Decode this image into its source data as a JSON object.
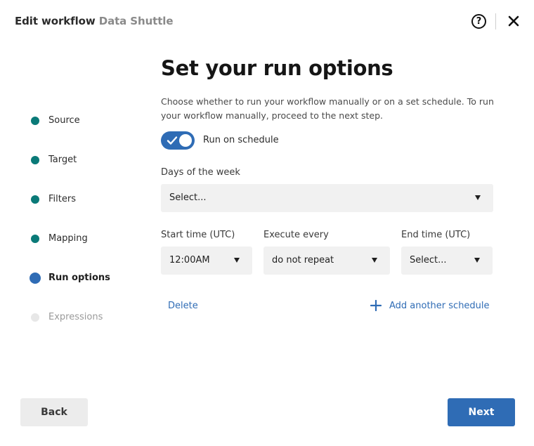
{
  "header": {
    "title_prefix": "Edit workflow",
    "workflow_name": "Data Shuttle",
    "help_icon": "question-circle-icon",
    "close_icon": "close-x-icon",
    "help_glyph": "?"
  },
  "steps": [
    {
      "label": "Source",
      "state": "complete"
    },
    {
      "label": "Target",
      "state": "complete"
    },
    {
      "label": "Filters",
      "state": "complete"
    },
    {
      "label": "Mapping",
      "state": "complete"
    },
    {
      "label": "Run options",
      "state": "current"
    },
    {
      "label": "Expressions",
      "state": "upcoming"
    }
  ],
  "main": {
    "title": "Set your run options",
    "description": "Choose whether to run your workflow manually or on a set schedule. To run your workflow manually, proceed to the next step.",
    "schedule_toggle": {
      "label": "Run on schedule",
      "checked": true
    },
    "days_of_week": {
      "label": "Days of the week",
      "value": "Select..."
    },
    "start_time": {
      "label": "Start time (UTC)",
      "value": "12:00AM"
    },
    "execute_every": {
      "label": "Execute every",
      "value": "do not repeat"
    },
    "end_time": {
      "label": "End time (UTC)",
      "value": "Select..."
    },
    "delete_label": "Delete",
    "add_schedule_label": "Add another schedule"
  },
  "footer": {
    "back_label": "Back",
    "next_label": "Next"
  },
  "colors": {
    "accent": "#2f6cb5",
    "step_complete": "#0a7a78",
    "step_upcoming": "#e7e7e7",
    "field_bg": "#f1f1f1"
  }
}
